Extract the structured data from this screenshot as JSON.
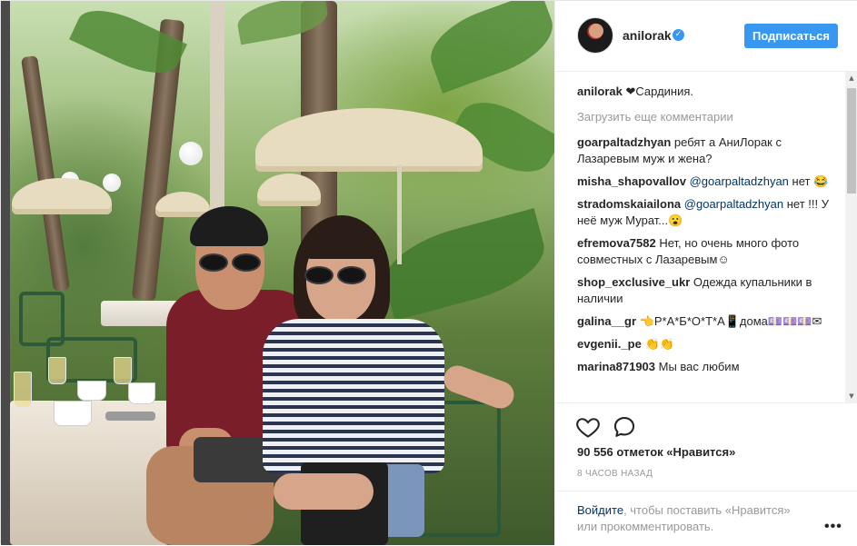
{
  "post": {
    "author": {
      "username": "anilorak",
      "verified_icon": "verified-check-icon"
    },
    "follow_label": "Подписаться",
    "caption": {
      "username": "anilorak",
      "text": "❤Сардиния."
    },
    "load_more_label": "Загрузить еще комментарии",
    "comments": [
      {
        "username": "goarpaltadzhyan",
        "mention": "",
        "text": "ребят а АниЛорак с Лазаревым муж и жена?"
      },
      {
        "username": "misha_shapovallov",
        "mention": "@goarpaltadzhyan",
        "text": "нет 😂"
      },
      {
        "username": "stradomskaiailona",
        "mention": "@goarpaltadzhyan",
        "text": "нет !!! У неё муж Мурат...😮"
      },
      {
        "username": "efremova7582",
        "mention": "",
        "text": "Нет, но очень много фото совместных с Лазаревым☺"
      },
      {
        "username": "shop_exclusive_ukr",
        "mention": "",
        "text": "Одежда купальники в наличии"
      },
      {
        "username": "galina__gr",
        "mention": "",
        "text": "👈Р*А*Б*О*Т*А📱дома💷💷💷✉"
      },
      {
        "username": "evgenii._pe",
        "mention": "",
        "text": "👏👏"
      },
      {
        "username": "marina871903",
        "mention": "",
        "text": "Мы вас любим"
      }
    ],
    "likes_text": "90 556 отметок «Нравится»",
    "timestamp": "8 ЧАСОВ НАЗАД",
    "login_prompt": {
      "link": "Войдите",
      "text": ", чтобы поставить «Нравится» или прокомментировать."
    },
    "more_icon": "more-options-icon"
  },
  "colors": {
    "accent": "#3897f0",
    "text": "#262626",
    "muted": "#999999",
    "mention": "#003569"
  }
}
